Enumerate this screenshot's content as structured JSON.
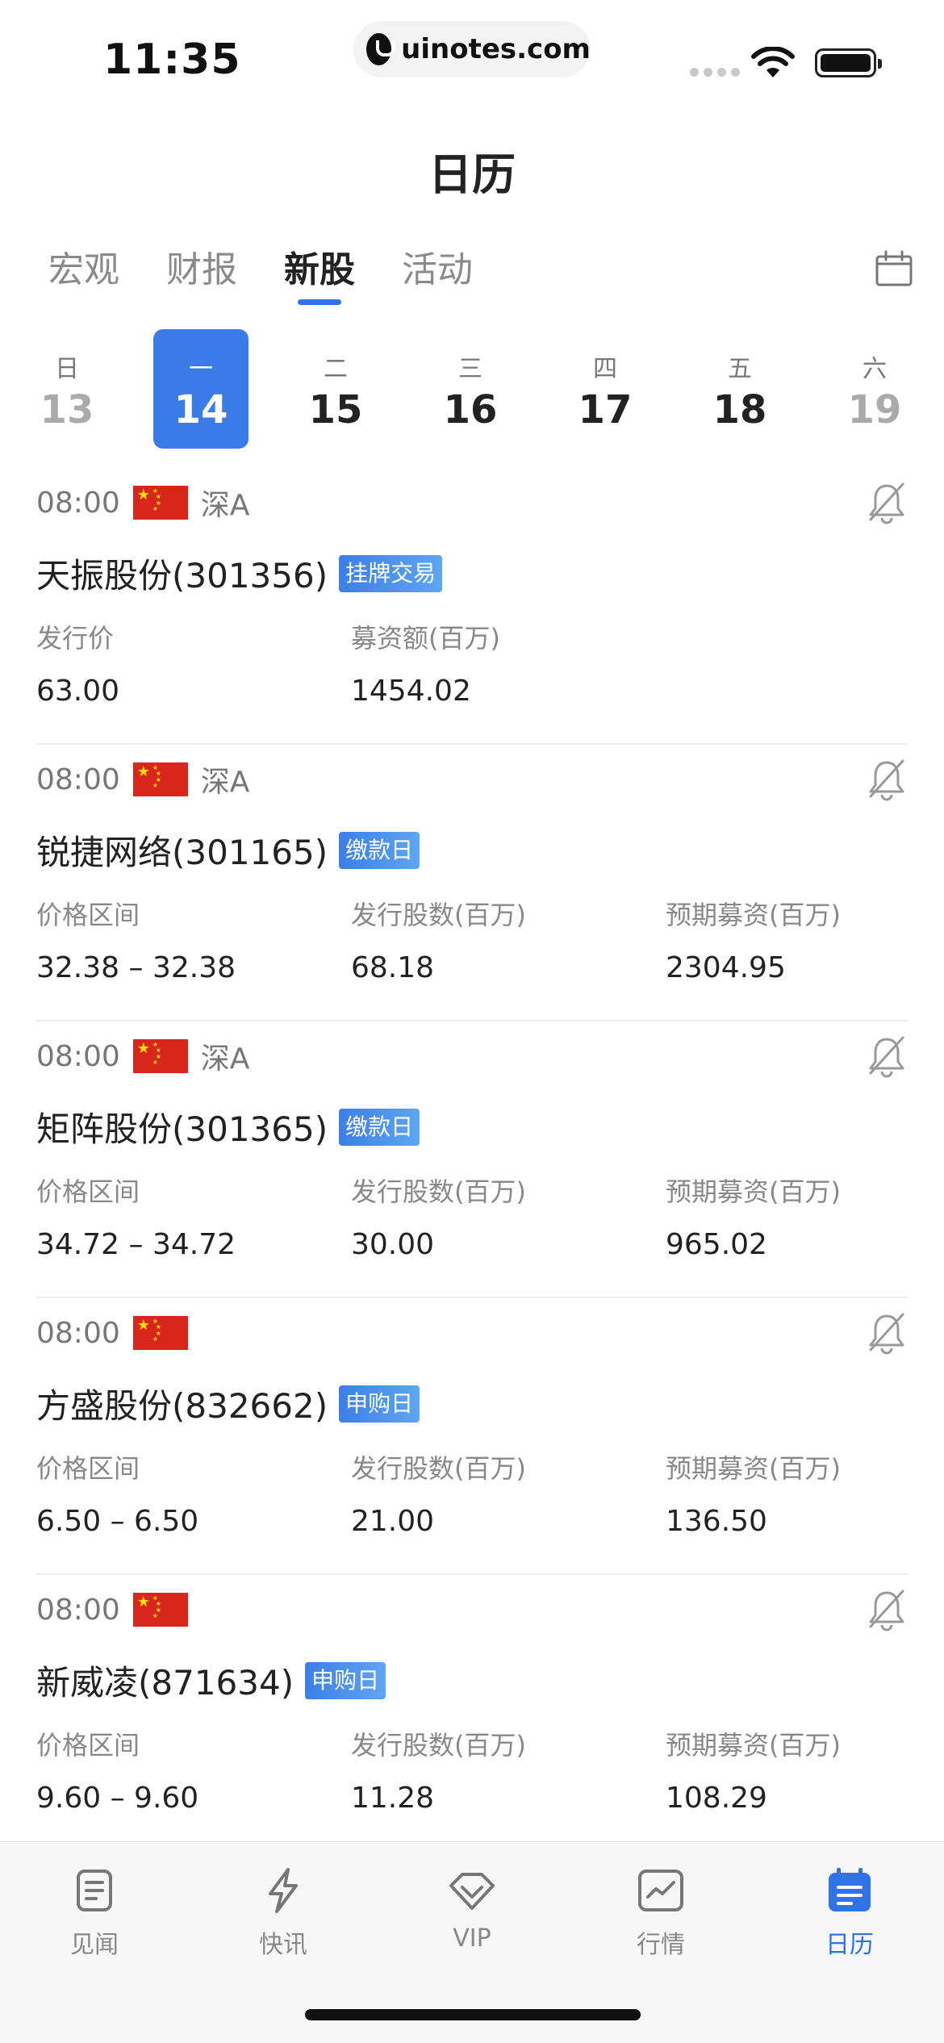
{
  "status": {
    "time": "11:35",
    "url": "uinotes.com"
  },
  "header": {
    "title": "日历"
  },
  "tabs": [
    {
      "label": "宏观",
      "active": false
    },
    {
      "label": "财报",
      "active": false
    },
    {
      "label": "新股",
      "active": true
    },
    {
      "label": "活动",
      "active": false
    }
  ],
  "week": [
    {
      "weekday": "日",
      "date": "13",
      "state": "dim"
    },
    {
      "weekday": "一",
      "date": "14",
      "state": "active"
    },
    {
      "weekday": "二",
      "date": "15",
      "state": "normal"
    },
    {
      "weekday": "三",
      "date": "16",
      "state": "normal"
    },
    {
      "weekday": "四",
      "date": "17",
      "state": "normal"
    },
    {
      "weekday": "五",
      "date": "18",
      "state": "normal"
    },
    {
      "weekday": "六",
      "date": "19",
      "state": "dim"
    }
  ],
  "listings": [
    {
      "time": "08:00",
      "market": "深A",
      "name": "天振股份(301356)",
      "badge": "挂牌交易",
      "fields": [
        {
          "label": "发行价",
          "value": "63.00"
        },
        {
          "label": "募资额(百万)",
          "value": "1454.02"
        }
      ]
    },
    {
      "time": "08:00",
      "market": "深A",
      "name": "锐捷网络(301165)",
      "badge": "缴款日",
      "fields": [
        {
          "label": "价格区间",
          "value": "32.38 – 32.38"
        },
        {
          "label": "发行股数(百万)",
          "value": "68.18"
        },
        {
          "label": "预期募资(百万)",
          "value": "2304.95"
        }
      ]
    },
    {
      "time": "08:00",
      "market": "深A",
      "name": "矩阵股份(301365)",
      "badge": "缴款日",
      "fields": [
        {
          "label": "价格区间",
          "value": "34.72 – 34.72"
        },
        {
          "label": "发行股数(百万)",
          "value": "30.00"
        },
        {
          "label": "预期募资(百万)",
          "value": "965.02"
        }
      ]
    },
    {
      "time": "08:00",
      "market": "",
      "name": "方盛股份(832662)",
      "badge": "申购日",
      "fields": [
        {
          "label": "价格区间",
          "value": "6.50 – 6.50"
        },
        {
          "label": "发行股数(百万)",
          "value": "21.00"
        },
        {
          "label": "预期募资(百万)",
          "value": "136.50"
        }
      ]
    },
    {
      "time": "08:00",
      "market": "",
      "name": "新威凌(871634)",
      "badge": "申购日",
      "fields": [
        {
          "label": "价格区间",
          "value": "9.60 – 9.60"
        },
        {
          "label": "发行股数(百万)",
          "value": "11.28"
        },
        {
          "label": "预期募资(百万)",
          "value": "108.29"
        }
      ]
    }
  ],
  "tabbar": [
    {
      "label": "见闻",
      "icon": "news-icon",
      "active": false
    },
    {
      "label": "快讯",
      "icon": "lightning-icon",
      "active": false
    },
    {
      "label": "VIP",
      "icon": "diamond-icon",
      "active": false
    },
    {
      "label": "行情",
      "icon": "chart-icon",
      "active": false
    },
    {
      "label": "日历",
      "icon": "calendar-icon",
      "active": true
    }
  ],
  "colors": {
    "accent": "#2f73e8",
    "badge": "#3b7fe8",
    "flag_red": "#d9261c",
    "flag_star": "#ffde00"
  }
}
